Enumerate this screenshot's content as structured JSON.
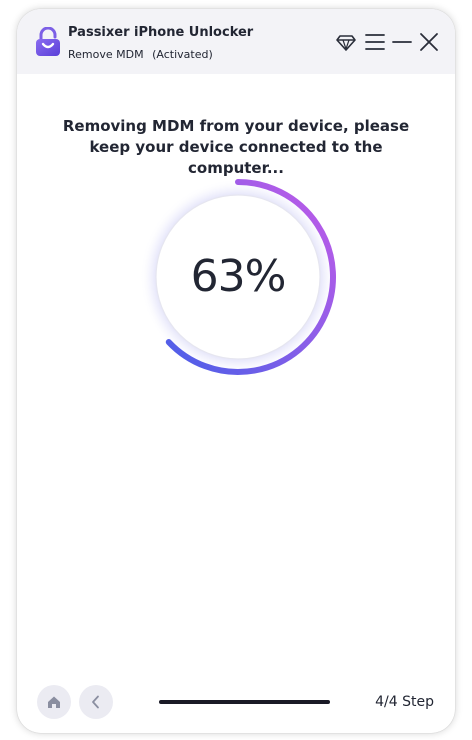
{
  "header": {
    "app_name": "Passixer iPhone Unlocker",
    "mode": "Remove MDM",
    "status": "(Activated)",
    "icons": [
      "diamond-icon",
      "menu-icon",
      "minimize-icon",
      "close-icon"
    ]
  },
  "main": {
    "message": "Removing MDM from your device, please keep your device connected to the computer...",
    "progress_percent": 63,
    "progress_label": "63%"
  },
  "footer": {
    "nav_icons": [
      "home-icon",
      "back-icon"
    ],
    "step_label": "4/4 Step"
  },
  "colors": {
    "accent_start": "#4a5ee8",
    "accent_end": "#c35ae8",
    "track": "#e6e6f0",
    "text": "#222633",
    "header_bg": "#f3f3f7"
  }
}
